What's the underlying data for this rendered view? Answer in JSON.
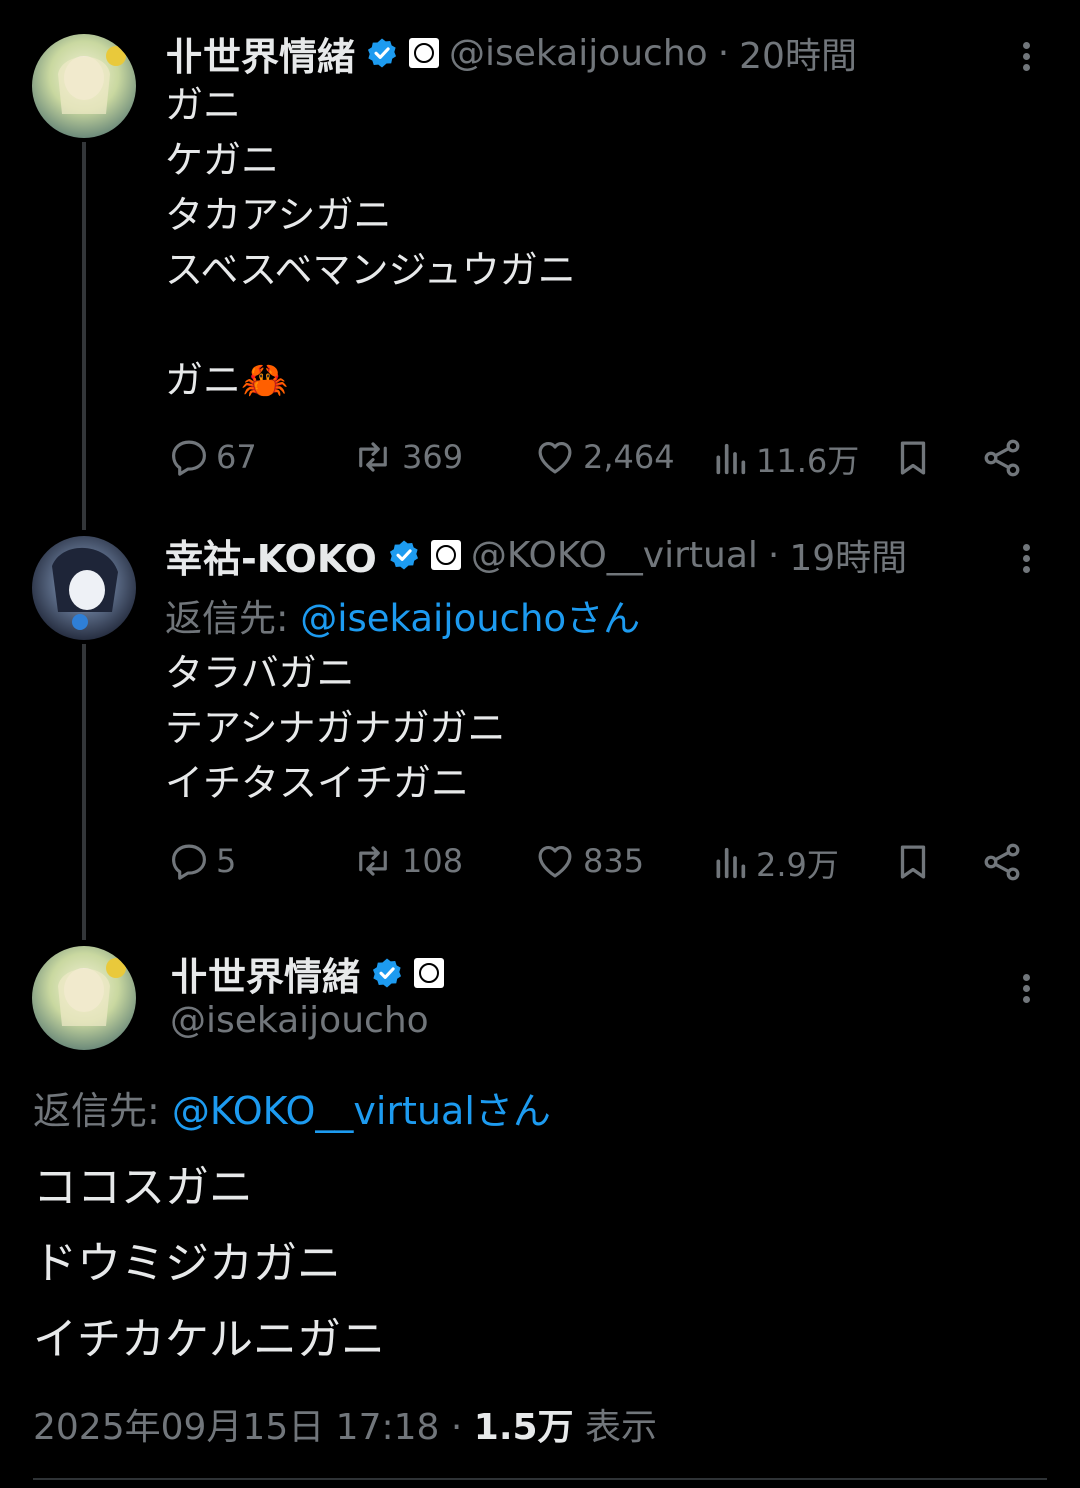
{
  "tweets": [
    {
      "name": "卝世界情緒",
      "handle": "@isekaijoucho",
      "time": "20時間",
      "lines": "ガニ\nケガニ\nタカアシガニ\nスベスベマンジュウガニ\n\nガニ🦀",
      "replies": "67",
      "retweets": "369",
      "likes": "2,464",
      "views": "11.6万"
    },
    {
      "name": "幸祜-KOKO",
      "handle": "@KOKO__virtual",
      "time": "19時間",
      "reply_label": "返信先: ",
      "reply_to": "@isekaijouchoさん",
      "lines": "タラバガニ\nテアシナガナガガニ\nイチタスイチガニ",
      "replies": "5",
      "retweets": "108",
      "likes": "835",
      "views": "2.9万"
    }
  ],
  "main": {
    "name": "卝世界情緒",
    "handle": "@isekaijoucho",
    "reply_label": "返信先: ",
    "reply_to": "@KOKO__virtualさん",
    "lines": "ココスガニ\nドウミジカガニ\nイチカケルニガニ",
    "date": "2025年09月15日 17:18",
    "sep": " · ",
    "views_count": "1.5万",
    "views_label": " 表示"
  },
  "colors": {
    "background": "#000000",
    "accent": "#1d9bf0",
    "muted": "#71767b",
    "text": "#e7e9ea"
  },
  "icons": [
    "reply-icon",
    "retweet-icon",
    "like-icon",
    "views-icon",
    "bookmark-icon",
    "share-icon",
    "verified-icon",
    "more-icon"
  ]
}
